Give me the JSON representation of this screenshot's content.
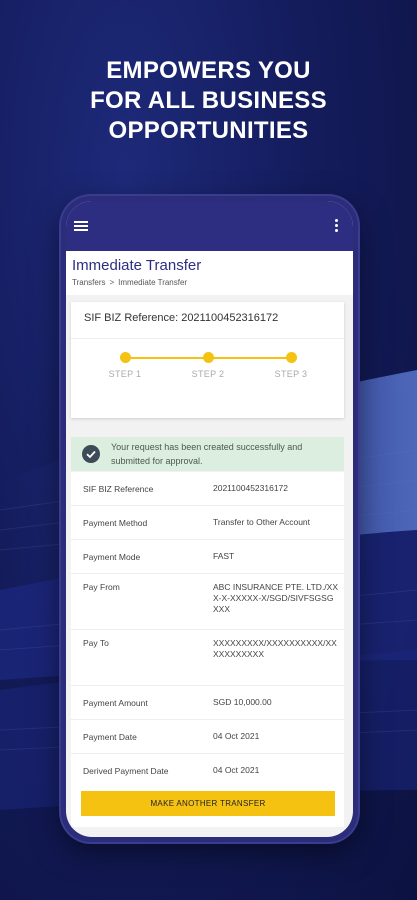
{
  "hero": {
    "line1": "EMPOWERS YOU",
    "line2": "FOR ALL BUSINESS",
    "line3": "OPPORTUNITIES"
  },
  "app": {
    "menu_icon": "hamburger-icon",
    "more_icon": "more-vertical-icon",
    "page_title": "Immediate Transfer",
    "breadcrumb": {
      "item1": "Transfers",
      "separator": ">",
      "item2": "Immediate Transfer"
    }
  },
  "reference": {
    "text": "SIF BIZ Reference: 2021100452316172"
  },
  "stepper": {
    "steps": [
      "STEP 1",
      "STEP 2",
      "STEP 3"
    ]
  },
  "success": {
    "icon": "check-circle-icon",
    "message": "Your request has been created successfully and submitted for approval."
  },
  "details": [
    {
      "label": "SIF BIZ Reference",
      "value": "2021100452316172"
    },
    {
      "label": "Payment Method",
      "value": "Transfer to Other Account"
    },
    {
      "label": "Payment Mode",
      "value": "FAST"
    },
    {
      "label": "Pay From",
      "value": "ABC INSURANCE PTE. LTD./XXX-X-XXXXX-X/SGD/SIVFSGSGXXX"
    },
    {
      "label": "Pay To",
      "value": "XXXXXXXXX/XXXXXXXXXX/XXXXXXXXXXX"
    },
    {
      "label": "Payment Amount",
      "value": "SGD 10,000.00"
    },
    {
      "label": "Payment Date",
      "value": "04 Oct 2021"
    },
    {
      "label": "Derived Payment Date",
      "value": "04 Oct 2021"
    }
  ],
  "action": {
    "button_label": "MAKE ANOTHER TRANSFER"
  },
  "colors": {
    "brand": "#2d2e82",
    "accent": "#f5c211",
    "success_bg": "#dceee0"
  }
}
